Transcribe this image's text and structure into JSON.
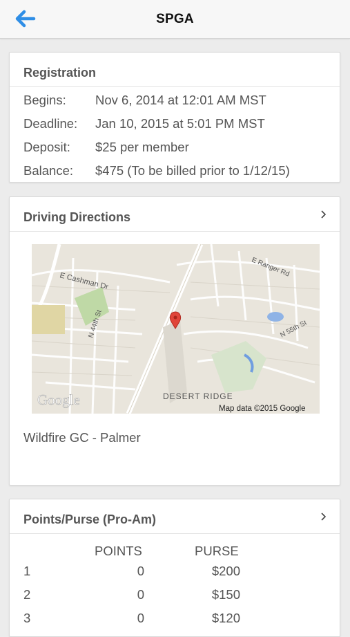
{
  "header": {
    "title": "SPGA",
    "back_icon": "back-arrow-icon",
    "accent": "#2f8ee6"
  },
  "registration": {
    "title": "Registration",
    "rows": [
      {
        "label": "Begins:",
        "value": "Nov 6, 2014 at 12:01 AM MST"
      },
      {
        "label": "Deadline:",
        "value": "Jan 10, 2015 at 5:01 PM MST"
      },
      {
        "label": "Deposit:",
        "value": "$25 per member"
      },
      {
        "label": "Balance:",
        "value": "$475 (To be billed prior to 1/12/15)"
      }
    ]
  },
  "directions": {
    "title": "Driving Directions",
    "map": {
      "streets": [
        "E Cashman Dr",
        "N 44th St",
        "E Ranger Rd",
        "N 55th St",
        "DESERT RIDGE"
      ],
      "attribution": "Map data ©2015 Google",
      "logo": "Google"
    },
    "venue": "Wildfire GC - Palmer"
  },
  "points": {
    "title": "Points/Purse (Pro-Am)",
    "columns": [
      "POINTS",
      "PURSE"
    ],
    "rows": [
      {
        "place": "1",
        "points": "0",
        "purse": "$200"
      },
      {
        "place": "2",
        "points": "0",
        "purse": "$150"
      },
      {
        "place": "3",
        "points": "0",
        "purse": "$120"
      }
    ]
  }
}
